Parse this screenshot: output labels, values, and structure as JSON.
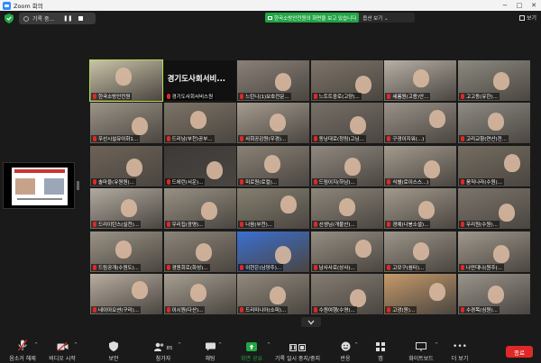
{
  "window": {
    "title": "Zoom 회의",
    "controls": [
      "−",
      "□",
      "✕"
    ]
  },
  "recording": {
    "label": "기록 중..."
  },
  "share_banner": {
    "text": "한국소방안전원의 화면을 보고 있습니다",
    "options_label": "옵션 보기"
  },
  "view": {
    "label": "보기"
  },
  "tiles": [
    {
      "name": "한국소방안전원",
      "bg": "#c9c2a8",
      "active": true
    },
    {
      "name": "경기도사회서비스원",
      "bg": "#111111",
      "black": true,
      "bigname": "경기도사회서비..."
    },
    {
      "name": "느탄니(1)보호전문...",
      "bg": "#8a8078"
    },
    {
      "name": "느트트중로(고양)...",
      "bg": "#7d7468"
    },
    {
      "name": "세롬원(고용)안...",
      "bg": "#b8b0a6"
    },
    {
      "name": "고고동(유한)...",
      "bg": "#8c8a80"
    },
    {
      "name": "우선시설유아화1...",
      "bg": "#9c9487"
    },
    {
      "name": "드리남(부천)공부...",
      "bg": "#7e7466"
    },
    {
      "name": "사회공감원(우경)...",
      "bg": "#a69c8f"
    },
    {
      "name": "동남대로(청림)고님...",
      "bg": "#777068"
    },
    {
      "name": "구경이지워(...)",
      "bg": "#9a9288"
    },
    {
      "name": "고리교향(연산)전...",
      "bg": "#8f8c84"
    },
    {
      "name": "솔마을(유원원)...",
      "bg": "#6d6357"
    },
    {
      "name": "드에런(서운)...",
      "bg": "#3c3a38"
    },
    {
      "name": "미로원(로컬)...",
      "bg": "#8a8276"
    },
    {
      "name": "드림이지(하남)...",
      "bg": "#918980"
    },
    {
      "name": "식별(로이스스...)",
      "bg": "#a49b8e"
    },
    {
      "name": "움직나라(수원)...",
      "bg": "#756d61"
    },
    {
      "name": "드리이턴스(실천)...",
      "bg": "#b1aaa0"
    },
    {
      "name": "우리집(광명)...",
      "bg": "#989184"
    },
    {
      "name": "나음(부천)...",
      "bg": "#85806f"
    },
    {
      "name": "선생님(개불산)...",
      "bg": "#8e867a"
    },
    {
      "name": "경예(나봉소셜)...",
      "bg": "#a39a8c"
    },
    {
      "name": "우리원(수원)...",
      "bg": "#7c756c"
    },
    {
      "name": "드림공개(수원도)...",
      "bg": "#9b9385"
    },
    {
      "name": "경원회로(화성)...",
      "bg": "#8b8478"
    },
    {
      "name": "이현은(남양주)...",
      "bg": "#3b6fd0"
    },
    {
      "name": "남사사로(상사)...",
      "bg": "#958e82"
    },
    {
      "name": "고모구(쉼터)...",
      "bg": "#9d958a"
    },
    {
      "name": "나만대나(원주)...",
      "bg": "#a0988c"
    },
    {
      "name": "네이아오션(구리)...",
      "bg": "#b8ada0"
    },
    {
      "name": "이시원(다산)...",
      "bg": "#a79f92"
    },
    {
      "name": "드리미니아(소피)...",
      "bg": "#938a7e"
    },
    {
      "name": "수원여행(수영)...",
      "bg": "#857d72"
    },
    {
      "name": "고광(원)...",
      "bg": "#c69a6a"
    },
    {
      "name": "수경목(심원)...",
      "bg": "#9a948c"
    }
  ],
  "toolbar": {
    "mute": "음소거 해제",
    "video": "비디오 시작",
    "security": "보안",
    "participants": "참가자",
    "participants_count": "85",
    "chat": "채팅",
    "share": "화면 공유",
    "record": "기록 일시 중지/중지",
    "reactions": "반응",
    "apps": "앱",
    "whiteboard": "화이트보드",
    "more": "더 보기",
    "end": "종료"
  },
  "colors": {
    "end_red": "#e02828",
    "share_green": "#22a544",
    "active_outline": "#b6d94a",
    "zoom_blue": "#2d8cff"
  }
}
